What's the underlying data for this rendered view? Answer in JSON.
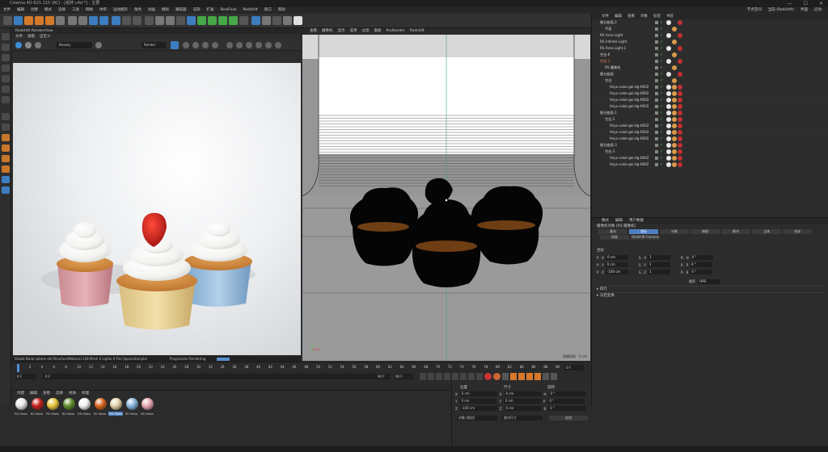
{
  "window": {
    "title": "Cinema 4D R21.115 (RC) - [纸杯.c4d *] - 主要",
    "controls": [
      "—",
      "☐",
      "✕"
    ]
  },
  "menubar": {
    "items": [
      "文件",
      "编辑",
      "创建",
      "模式",
      "选择",
      "工具",
      "网格",
      "体积",
      "运动图形",
      "角色",
      "动画",
      "模拟",
      "跟踪器",
      "渲染",
      "扩展",
      "RealFlow",
      "Redshift",
      "窗口",
      "帮助"
    ],
    "right_items": [
      "节点空间",
      "当前 (Redshift)",
      "界面",
      "启动"
    ]
  },
  "render_view": {
    "title": "Redshift RenderView",
    "menu": [
      "文件",
      "视图",
      "自定义"
    ],
    "preset_select": "Beauty",
    "render_select": "Render",
    "status_text": "Shade Node sphere std StructureMaterial 148 Mesh 0 Lights 0 Fire SparseSampler",
    "progress_label": "Progressive Rendering"
  },
  "viewport": {
    "menu": [
      "查看",
      "摄像机",
      "显示",
      "选项",
      "过滤",
      "面板",
      "ProRender",
      "Redshift"
    ],
    "grid_label": "网格间距 : 5 cm"
  },
  "object_manager": {
    "tabs": [
      "文件",
      "编辑",
      "查看",
      "对象",
      "标签",
      "书签"
    ],
    "rows": [
      {
        "name": "细分曲面.2",
        "indent": 1,
        "color": "#d8d8d8"
      },
      {
        "name": "平面",
        "indent": 2,
        "color": "#d8d8d8"
      },
      {
        "name": "RS Area Light",
        "indent": 1,
        "color": "#d8d8d8"
      },
      {
        "name": "RS Infinite Light",
        "indent": 1,
        "color": "#d8d8d8"
      },
      {
        "name": "RS Area Light.1",
        "indent": 1,
        "color": "#d8d8d8"
      },
      {
        "name": "空白.6",
        "indent": 1,
        "color": "#d8d8d8"
      },
      {
        "name": "空白.1",
        "indent": 1,
        "color": "#e88a5a"
      },
      {
        "name": "RS 摄像机",
        "indent": 2,
        "color": "#d8d8d8"
      },
      {
        "name": "细分曲面",
        "indent": 1,
        "color": "#d8d8d8"
      },
      {
        "name": "空白",
        "indent": 2,
        "color": "#d8d8d8"
      },
      {
        "name": "feiyu-cake-gai-dg-0002",
        "indent": 3,
        "color": "#d8d8d8"
      },
      {
        "name": "feiyu-cake-gai-dg-0002",
        "indent": 3,
        "color": "#d8d8d8"
      },
      {
        "name": "feiyu-cake-gai-dg-0002",
        "indent": 3,
        "color": "#d8d8d8"
      },
      {
        "name": "feiyu-cake-gai-dg-0002",
        "indent": 3,
        "color": "#d8d8d8"
      },
      {
        "name": "细分曲面.1",
        "indent": 1,
        "color": "#d8d8d8"
      },
      {
        "name": "空白.2",
        "indent": 2,
        "color": "#d8d8d8"
      },
      {
        "name": "feiyu-cake-gai-dg-0002",
        "indent": 3,
        "color": "#d8d8d8"
      },
      {
        "name": "feiyu-cake-gai-dg-0002",
        "indent": 3,
        "color": "#d8d8d8"
      },
      {
        "name": "feiyu-cake-gai-dg-0002",
        "indent": 3,
        "color": "#d8d8d8"
      },
      {
        "name": "细分曲面.3",
        "indent": 1,
        "color": "#d8d8d8"
      },
      {
        "name": "空白.3",
        "indent": 2,
        "color": "#d8d8d8"
      },
      {
        "name": "feiyu-cake-gai-dg-0002",
        "indent": 3,
        "color": "#d8d8d8"
      },
      {
        "name": "feiyu-cake-gai-dg-0002",
        "indent": 3,
        "color": "#d8d8d8"
      }
    ]
  },
  "attributes": {
    "tabs": [
      "模式",
      "编辑",
      "用户数据"
    ],
    "subtitle": "摄像机对象 [RS 摄像机]",
    "buttons": [
      "基本",
      "坐标",
      "对象",
      "物理",
      "细节",
      "立体",
      "合成"
    ],
    "active_button": 1,
    "sub_buttons": [
      "球面",
      "Redshift Camera"
    ],
    "section": "坐标",
    "params": [
      {
        "a": "P . X",
        "av": "0 cm",
        "b": "S . X",
        "bv": "1",
        "c": "R . H",
        "cv": "0 °"
      },
      {
        "a": "P . Y",
        "av": "0 cm",
        "b": "S . Y",
        "bv": "1",
        "c": "R . P",
        "cv": "0 °"
      },
      {
        "a": "P . Z",
        "av": "-100 cm",
        "b": "S . Z",
        "bv": "1",
        "c": "R . B",
        "cv": "0 °"
      }
    ],
    "order_label": "顺序",
    "order_value": "HPB",
    "folds": [
      "四元",
      "冻结变换"
    ]
  },
  "timeline": {
    "ticks": [
      "0",
      "2",
      "4",
      "6",
      "8",
      "10",
      "12",
      "14",
      "16",
      "18",
      "20",
      "22",
      "24",
      "26",
      "28",
      "30",
      "32",
      "34",
      "36",
      "38",
      "40",
      "42",
      "44",
      "46",
      "48",
      "50",
      "52",
      "54",
      "56",
      "58",
      "60",
      "62",
      "64",
      "66",
      "68",
      "70",
      "72",
      "74",
      "76",
      "78",
      "80",
      "82",
      "84",
      "86",
      "88",
      "90"
    ],
    "current_frame": "0 F",
    "start_frame": "0 F",
    "end_frame": "90 F",
    "max_frame": "90 F",
    "end_readout": "0 F"
  },
  "materials": {
    "tabs": [
      "创建",
      "编辑",
      "查看",
      "选择",
      "材质",
      "纹理"
    ],
    "items": [
      {
        "label": "RS Mate",
        "color": "#e8e8e8"
      },
      {
        "label": "RS Mate",
        "color": "#c8221e"
      },
      {
        "label": "RS Mate",
        "color": "#e8c53a"
      },
      {
        "label": "RS Mate",
        "color": "#5f8f2a"
      },
      {
        "label": "RS Mate",
        "color": "#f0f0f0"
      },
      {
        "label": "RS Mate",
        "color": "#d8641c"
      },
      {
        "label": "RS Mate",
        "color": "#e4d2a8"
      },
      {
        "label": "RS Mate",
        "color": "#86b4dc"
      },
      {
        "label": "RS Mate",
        "color": "#e8a8b0"
      }
    ]
  },
  "coordinates": {
    "headers": [
      "位置",
      "尺寸",
      "旋转"
    ],
    "rows": [
      {
        "l1": "X",
        "v1": "0 cm",
        "l2": "X",
        "v2": "0 cm",
        "l3": "H",
        "v3": "0 °"
      },
      {
        "l1": "Y",
        "v1": "0 cm",
        "l2": "Y",
        "v2": "0 cm",
        "l3": "P",
        "v3": "0 °"
      },
      {
        "l1": "Z",
        "v1": "-100 cm",
        "l2": "Z",
        "v2": "0 cm",
        "l3": "B",
        "v3": "0 °"
      }
    ],
    "mode1": "对象 (相对)",
    "mode2": "绝对尺寸",
    "apply": "应用"
  }
}
